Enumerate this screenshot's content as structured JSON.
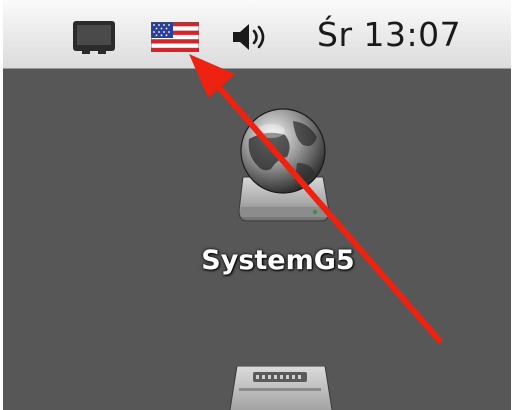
{
  "menubar": {
    "items": [
      {
        "name": "display-icon"
      },
      {
        "name": "us-flag-input-menu-icon"
      },
      {
        "name": "volume-icon"
      }
    ],
    "clock": "Śr 13:07"
  },
  "desktop": {
    "items": [
      {
        "label": "SystemG5",
        "icon": "network-drive-globe-icon"
      },
      {
        "label": "",
        "icon": "hard-drive-icon"
      }
    ]
  },
  "annotation": {
    "color": "#ee2211",
    "points_to": "us-flag-input-menu-icon"
  }
}
